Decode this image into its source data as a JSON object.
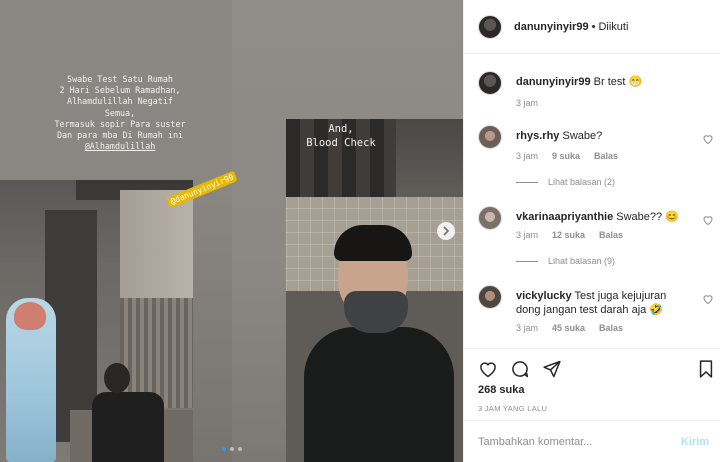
{
  "media": {
    "left_overlay_lines": [
      "Swabe Test Satu Rumah",
      "2 Hari Sebelum Ramadhan,",
      "Alhamdulillah Negatif",
      "Semua,",
      "Termasuk sopir Para suster",
      "Dan para mba Di Rumah ini",
      "@Alhamdulillah"
    ],
    "left_sticker": "@danunyinyir99",
    "right_caption_line1": "And,",
    "right_caption_line2": "Blood Check",
    "carousel": {
      "count": 3,
      "active_index": 0
    }
  },
  "header": {
    "username": "danunyinyir99",
    "separator": "•",
    "follow_status": "Diikuti"
  },
  "caption": {
    "username": "danunyinyir99",
    "text": "Br test 😁",
    "time": "3 jam"
  },
  "comments": [
    {
      "username": "rhys.rhy",
      "text": "Swabe?",
      "time": "3 jam",
      "likes": "9 suka",
      "reply_label": "Balas",
      "view_replies": "Lihat balasan (2)"
    },
    {
      "username": "vkarinaapriyanthie",
      "text": "Swabe?? 😊",
      "time": "3 jam",
      "likes": "12 suka",
      "reply_label": "Balas",
      "view_replies": "Lihat balasan (9)"
    },
    {
      "username": "vickylucky",
      "text": "Test juga kejujuran dong jangan test darah aja 🤣",
      "time": "3 jam",
      "likes": "45 suka",
      "reply_label": "Balas"
    }
  ],
  "actions": {
    "likes": "268 suka",
    "posted_time": "3 JAM YANG LALU"
  },
  "add_comment": {
    "placeholder": "Tambahkan komentar...",
    "post_label": "Kirim"
  },
  "colors": {
    "text": "#262626",
    "muted": "#8e8e8e",
    "border": "#efefef",
    "post_disabled": "#b2dffc",
    "carousel_active": "#3897f0"
  }
}
